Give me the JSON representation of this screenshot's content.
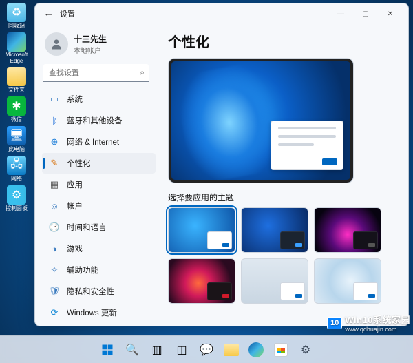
{
  "desktop": {
    "icons": [
      {
        "name": "recycle-bin",
        "label": "回收站"
      },
      {
        "name": "edge",
        "label": "Microsoft Edge"
      },
      {
        "name": "folder",
        "label": "文件夹"
      },
      {
        "name": "wechat",
        "label": "微信"
      },
      {
        "name": "this-pc",
        "label": "此电脑"
      },
      {
        "name": "network",
        "label": "网络"
      },
      {
        "name": "control-panel",
        "label": "控制面板"
      }
    ]
  },
  "window": {
    "title": "设置",
    "user": {
      "name": "十三先生",
      "type": "本地帐户"
    },
    "search": {
      "placeholder": "查找设置"
    },
    "nav": {
      "items": [
        {
          "key": "system",
          "label": "系统"
        },
        {
          "key": "bluetooth",
          "label": "蓝牙和其他设备"
        },
        {
          "key": "network",
          "label": "网络 & Internet"
        },
        {
          "key": "personalization",
          "label": "个性化",
          "selected": true
        },
        {
          "key": "apps",
          "label": "应用"
        },
        {
          "key": "accounts",
          "label": "帐户"
        },
        {
          "key": "time",
          "label": "时间和语言"
        },
        {
          "key": "gaming",
          "label": "游戏"
        },
        {
          "key": "accessibility",
          "label": "辅助功能"
        },
        {
          "key": "privacy",
          "label": "隐私和安全性"
        },
        {
          "key": "update",
          "label": "Windows 更新"
        }
      ]
    }
  },
  "main": {
    "heading": "个性化",
    "themes_label": "选择要应用的主题",
    "themes": [
      {
        "id": "light-blue-bloom",
        "selected": true,
        "accent": "#0067c0"
      },
      {
        "id": "dark-blue-bloom",
        "selected": false,
        "accent": "#3aa0ff"
      },
      {
        "id": "dark-magenta",
        "selected": false,
        "accent": "#555555"
      },
      {
        "id": "dark-sunrise",
        "selected": false,
        "accent": "#d11a2a"
      },
      {
        "id": "light-gray",
        "selected": false,
        "accent": "#0067c0"
      },
      {
        "id": "light-flow",
        "selected": false,
        "accent": "#0067c0"
      }
    ]
  },
  "taskbar": {
    "items": [
      "start",
      "search",
      "task-view",
      "widgets",
      "chat",
      "explorer",
      "edge",
      "store",
      "settings"
    ]
  },
  "watermark": {
    "badge": "10",
    "title": "Win10系统家园",
    "url": "www.qdhuajin.com"
  }
}
